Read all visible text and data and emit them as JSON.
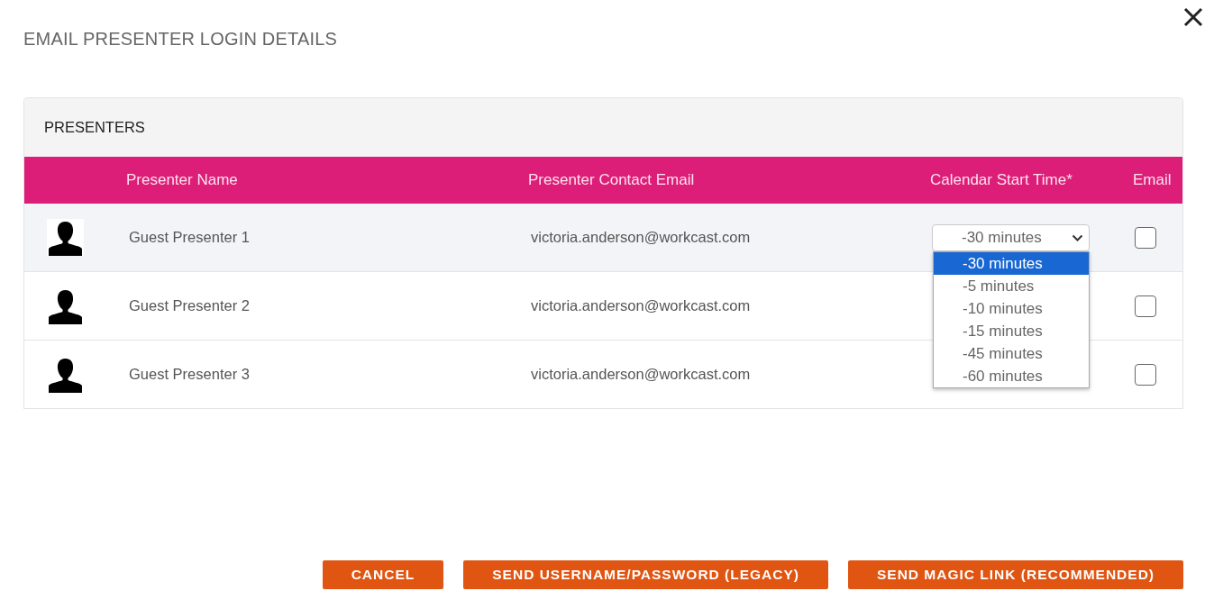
{
  "dialog": {
    "title": "EMAIL PRESENTER LOGIN DETAILS"
  },
  "presenters": {
    "title": "PRESENTERS",
    "columns": [
      "Presenter Name",
      "Presenter Contact Email",
      "Calendar Start Time*",
      "Email"
    ],
    "rows": [
      {
        "name": "Guest Presenter 1",
        "email": "victoria.anderson@workcast.com",
        "highlighted": true,
        "start_time": {
          "value": "-30 minutes",
          "open": true,
          "options": [
            {
              "label": "-30 minutes",
              "selected": true
            },
            {
              "label": "-5 minutes",
              "selected": false
            },
            {
              "label": "-10 minutes",
              "selected": false
            },
            {
              "label": "-15 minutes",
              "selected": false
            },
            {
              "label": "-45 minutes",
              "selected": false
            },
            {
              "label": "-60 minutes",
              "selected": false
            }
          ]
        },
        "checked": false
      },
      {
        "name": "Guest Presenter 2",
        "email": "victoria.anderson@workcast.com",
        "highlighted": false,
        "checked": false
      },
      {
        "name": "Guest Presenter 3",
        "email": "victoria.anderson@workcast.com",
        "highlighted": false,
        "checked": false
      }
    ]
  },
  "buttons": [
    {
      "label": "CANCEL"
    },
    {
      "label": "SEND USERNAME/PASSWORD (LEGACY)"
    },
    {
      "label": "SEND MAGIC LINK (RECOMMENDED)"
    }
  ]
}
